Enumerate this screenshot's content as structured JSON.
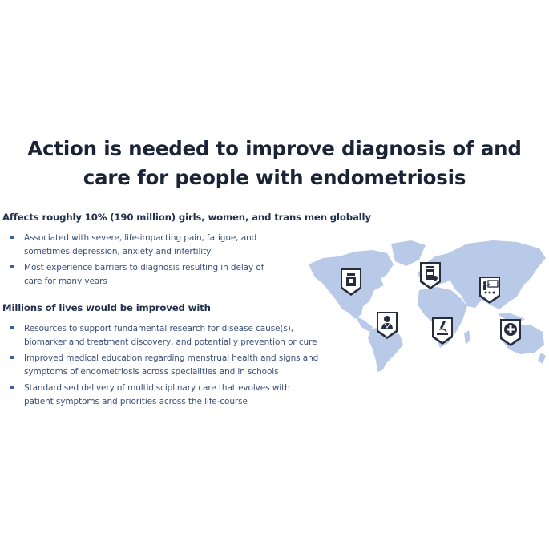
{
  "title": {
    "line1": "Action is needed to improve diagnosis of and",
    "line2": "care for people with endometriosis"
  },
  "section1": {
    "heading": "Affects roughly 10% (190 million) girls, women, and trans men globally",
    "bullets": [
      {
        "line1": "Associated with severe, life-impacting pain, fatigue, and",
        "line2": "sometimes depression, anxiety and infertility"
      },
      {
        "line1": "Most experience barriers to diagnosis resulting in delay of",
        "line2": "care for many years"
      }
    ]
  },
  "section2": {
    "heading": "Millions of lives would be improved with",
    "bullets": [
      {
        "line1": "Resources to support fundamental research for disease cause(s),",
        "line2": "biomarker and treatment discovery, and potentially prevention or cure"
      },
      {
        "line1": "Improved medical education regarding menstrual health and signs and",
        "line2": "symptoms of endometriosis across specialities and in schools"
      },
      {
        "line1": "Standardised delivery of multidisciplinary care that evolves with",
        "line2": "patient symptoms and priorities across the life-course"
      }
    ]
  },
  "map": {
    "land_color": "#b9c9e8",
    "badge_color": "#262d3f",
    "icons": [
      "lab-jar-icon",
      "medicine-bottle-icon",
      "teacher-presentation-icon",
      "doctor-icon",
      "microscope-icon",
      "medical-cross-icon"
    ]
  }
}
